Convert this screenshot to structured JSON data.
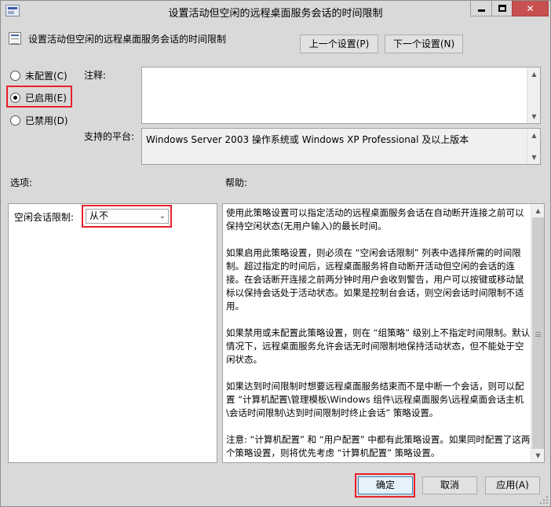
{
  "window": {
    "title": "设置活动但空闲的远程桌面服务会话的时间限制"
  },
  "header": {
    "policy_title": "设置活动但空闲的远程桌面服务会话的时间限制",
    "prev_button": "上一个设置(P)",
    "next_button": "下一个设置(N)"
  },
  "state": {
    "options": [
      {
        "label": "未配置(C)",
        "checked": false
      },
      {
        "label": "已启用(E)",
        "checked": true
      },
      {
        "label": "已禁用(D)",
        "checked": false
      }
    ]
  },
  "comment": {
    "label": "注释:",
    "value": ""
  },
  "platform": {
    "label": "支持的平台:",
    "value": "Windows Server 2003 操作系统或 Windows XP Professional 及以上版本"
  },
  "options_panel": {
    "heading": "选项:",
    "idle_limit_label": "空闲会话限制:",
    "idle_limit_value": "从不"
  },
  "help_panel": {
    "heading": "帮助:",
    "paragraphs": [
      "使用此策略设置可以指定活动的远程桌面服务会话在自动断开连接之前可以保持空闲状态(无用户输入)的最长时间。",
      "如果启用此策略设置，则必须在 “空闲会话限制” 列表中选择所需的时间限制。超过指定的时间后，远程桌面服务将自动断开活动但空闲的会话的连接。在会话断开连接之前两分钟时用户会收到警告，用户可以按键或移动鼠标以保持会话处于活动状态。如果是控制台会话，则空闲会话时间限制不适用。",
      "如果禁用或未配置此策略设置，则在 “组策略” 级别上不指定时间限制。默认情况下，远程桌面服务允许会话无时间限制地保持活动状态，但不能处于空闲状态。",
      "如果达到时间限制时想要远程桌面服务结束而不是中断一个会话，则可以配置 “计算机配置\\管理模板\\Windows 组件\\远程桌面服务\\远程桌面会话主机\\会话时间限制\\达到时间限制时终止会话” 策略设置。",
      "注意: “计算机配置” 和 “用户配置” 中都有此策略设置。如果同时配置了这两个策略设置，则将优先考虑 “计算机配置” 策略设置。"
    ]
  },
  "footer": {
    "ok": "确定",
    "cancel": "取消",
    "apply": "应用(A)"
  },
  "colors": {
    "highlight": "#e8202a",
    "window_bg": "#d9d9d9",
    "close_button": "#c75050"
  }
}
